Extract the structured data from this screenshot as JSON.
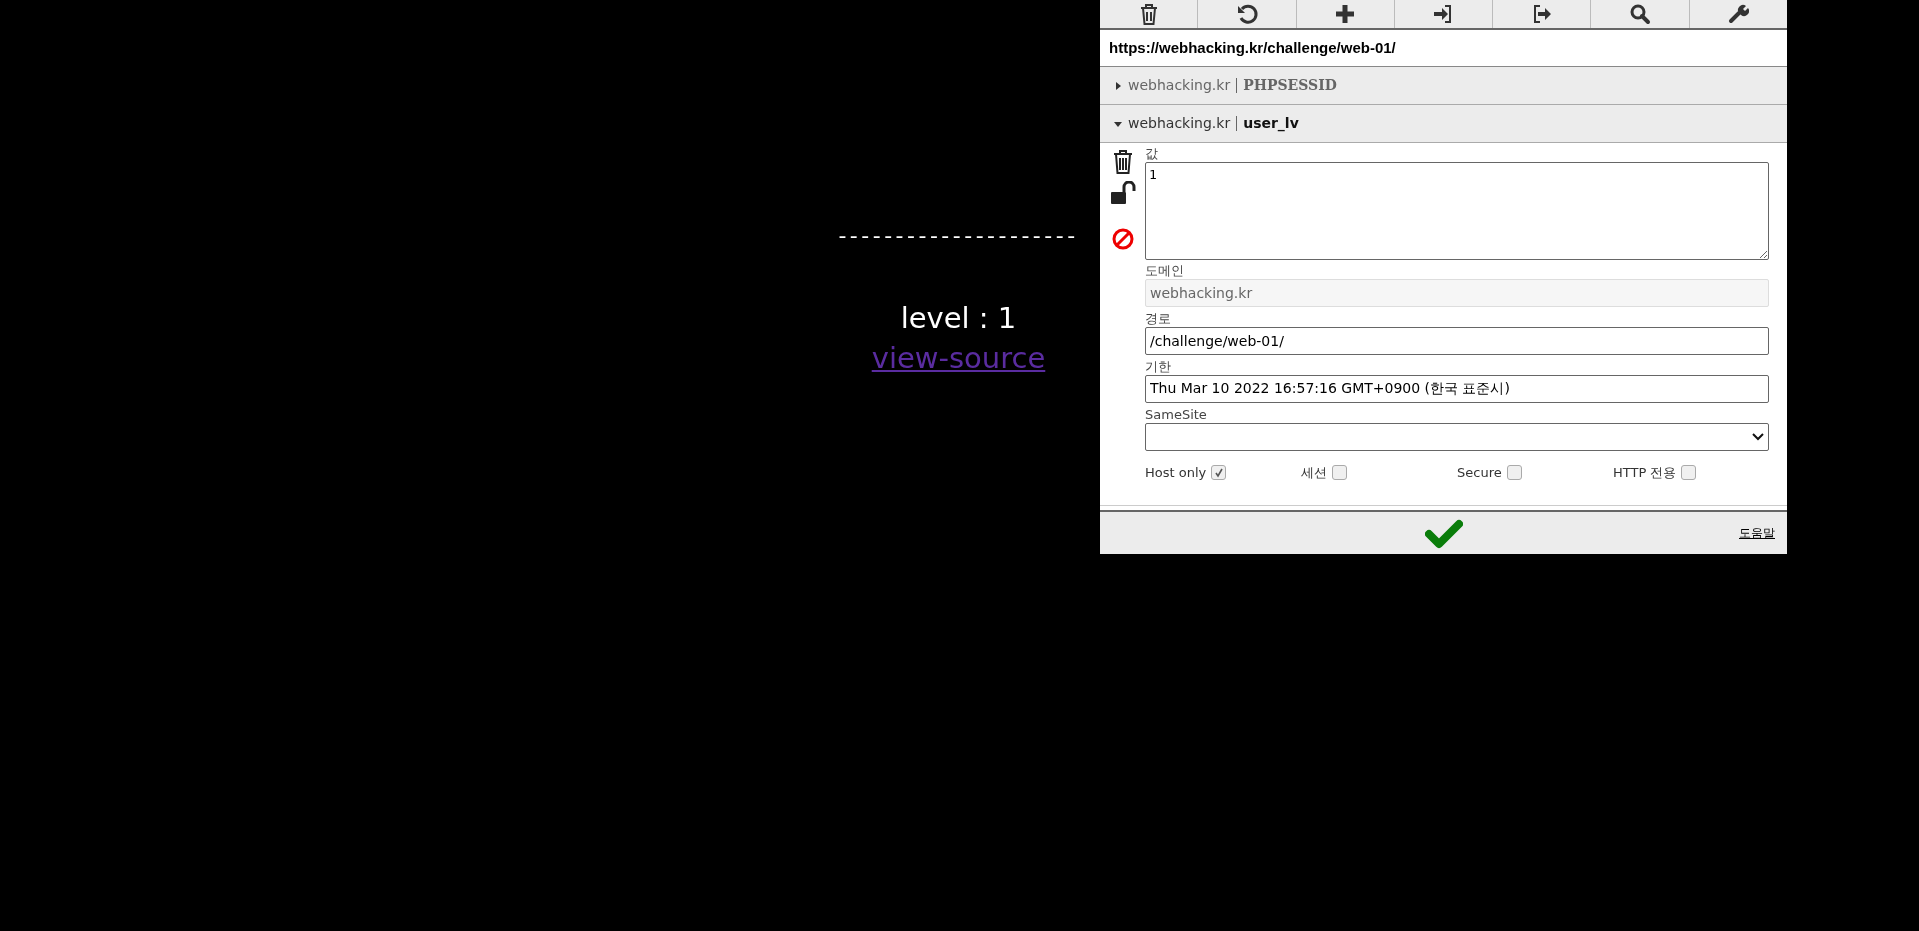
{
  "page": {
    "separator": "---------------------",
    "level_text": "level : 1",
    "link": "view-source"
  },
  "popup": {
    "url": "https://webhacking.kr/challenge/web-01/",
    "cookies": [
      {
        "domain": "webhacking.kr",
        "name": "PHPSESSID",
        "expanded": false
      },
      {
        "domain": "webhacking.kr",
        "name": "user_lv",
        "expanded": true
      }
    ],
    "editor": {
      "value_label": "값",
      "value": "1",
      "domain_label": "도메인",
      "domain": "webhacking.kr",
      "domain_disabled": true,
      "path_label": "경로",
      "path": "/challenge/web-01/",
      "expires_label": "기한",
      "expires": "Thu Mar 10 2022 16:57:16 GMT+0900 (한국 표준시)",
      "samesite_label": "SameSite",
      "flags": [
        {
          "label": "Host only",
          "checked": true
        },
        {
          "label": "세션",
          "checked": false
        },
        {
          "label": "Secure",
          "checked": false
        },
        {
          "label": "HTTP 전용",
          "checked": false
        }
      ]
    },
    "footer": {
      "help_link": "도움말"
    }
  }
}
